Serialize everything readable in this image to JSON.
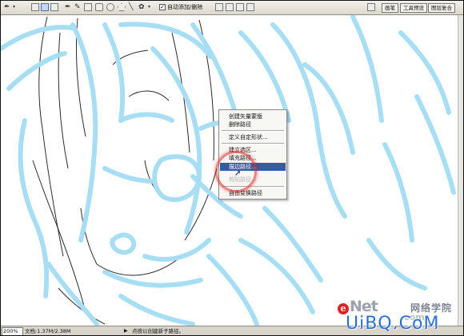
{
  "options_bar": {
    "auto_add_delete_checked": true,
    "auto_add_delete_label": "自动添加/删除",
    "panel_tabs": [
      "画笔",
      "工具预设",
      "图层复合"
    ]
  },
  "context_menu": {
    "items": [
      {
        "label": "创建矢量蒙版",
        "disabled": false,
        "selected": false
      },
      {
        "label": "删除路径",
        "disabled": false,
        "selected": false
      },
      {
        "separator": true
      },
      {
        "label": "定义自定形状...",
        "disabled": false,
        "selected": false
      },
      {
        "separator": true
      },
      {
        "label": "建立选区...",
        "disabled": false,
        "selected": false
      },
      {
        "label": "填充路径...",
        "disabled": false,
        "selected": false
      },
      {
        "label": "描边路径...",
        "disabled": false,
        "selected": true
      },
      {
        "label": "剪贴路径...",
        "disabled": true,
        "selected": false
      },
      {
        "separator": true
      },
      {
        "label": "自由变换路径",
        "disabled": false,
        "selected": false
      }
    ]
  },
  "status_bar": {
    "zoom": "200%",
    "doc_info": "文档:1.37M/2.38M",
    "hint": "点按以创建新子路径。"
  },
  "watermark": {
    "e": "e",
    "net": "Net",
    "cn": "网络学院",
    "com": ".com",
    "ubq": "UiBQ.CoM"
  },
  "colors": {
    "stroke_path": "#a8def4",
    "menu_selected": "#2f5ea8",
    "ring": "#dc2828"
  },
  "icons": {
    "tool_pen": "pen-icon",
    "cursor": "arrow-cursor-icon"
  }
}
